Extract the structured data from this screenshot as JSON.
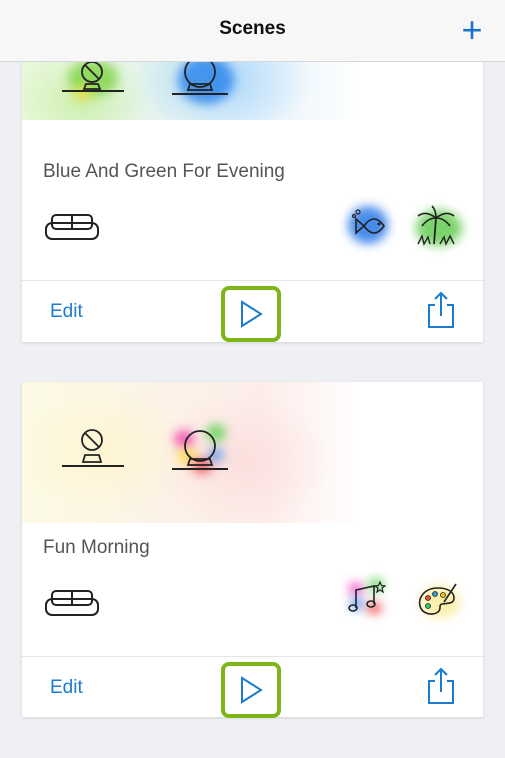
{
  "header": {
    "title": "Scenes",
    "add_icon": "plus-icon",
    "add_symbol": "+"
  },
  "colors": {
    "accent": "#1a7bd0",
    "play_highlight": "#7cb518"
  },
  "scenes": [
    {
      "name": "Blue And Green For Evening",
      "room_icon": "sofa-icon",
      "scene_icons": [
        "fish-icon",
        "palm-tree-icon"
      ],
      "light_icons": [
        "wall-lamp-icon",
        "globe-lamp-icon"
      ],
      "edit_label": "Edit",
      "play_icon": "play-icon",
      "share_icon": "share-icon"
    },
    {
      "name": "Fun Morning",
      "room_icon": "sofa-icon",
      "scene_icons": [
        "music-notes-icon",
        "palette-icon"
      ],
      "light_icons": [
        "wall-lamp-icon",
        "globe-lamp-icon"
      ],
      "edit_label": "Edit",
      "play_icon": "play-icon",
      "share_icon": "share-icon"
    }
  ]
}
